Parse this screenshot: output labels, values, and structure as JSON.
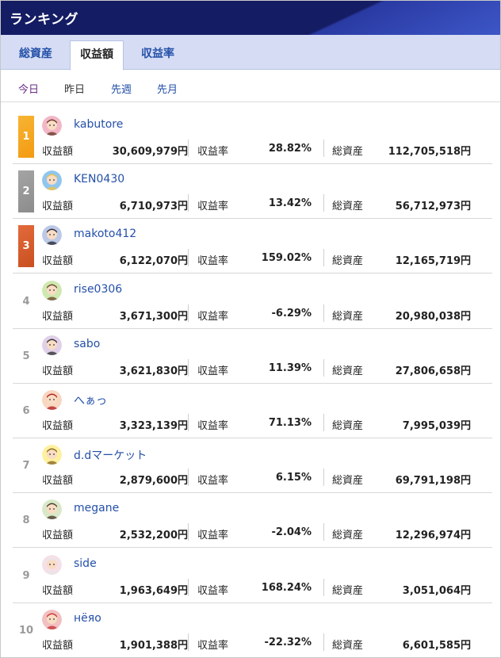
{
  "header": {
    "title": "ランキング"
  },
  "tabs": [
    {
      "label": "総資産",
      "active": false
    },
    {
      "label": "収益額",
      "active": true
    },
    {
      "label": "収益率",
      "active": false
    }
  ],
  "subtabs": [
    {
      "label": "今日"
    },
    {
      "label": "昨日"
    },
    {
      "label": "先週"
    },
    {
      "label": "先月"
    }
  ],
  "stat_labels": {
    "profit": "収益額",
    "rate": "収益率",
    "assets": "総資産"
  },
  "rows": [
    {
      "rank": "1",
      "name": "kabutore",
      "profit": "30,609,979円",
      "rate": "28.82%",
      "assets": "112,705,518円",
      "avatar": "avatar-woman-icon"
    },
    {
      "rank": "2",
      "name": "KEN0430",
      "profit": "6,710,973円",
      "rate": "13.42%",
      "assets": "56,712,973円",
      "avatar": "avatar-blonde-icon"
    },
    {
      "rank": "3",
      "name": "makoto412",
      "profit": "6,122,070円",
      "rate": "159.02%",
      "assets": "12,165,719円",
      "avatar": "avatar-suit-man-icon"
    },
    {
      "rank": "4",
      "name": "rise0306",
      "profit": "3,671,300円",
      "rate": "-6.29%",
      "assets": "20,980,038円",
      "avatar": "avatar-green-man-icon"
    },
    {
      "rank": "5",
      "name": "sabo",
      "profit": "3,621,830円",
      "rate": "11.39%",
      "assets": "27,806,658円",
      "avatar": "avatar-goggles-icon"
    },
    {
      "rank": "6",
      "name": "へぁっ",
      "profit": "3,323,139円",
      "rate": "71.13%",
      "assets": "7,995,039円",
      "avatar": "avatar-pirate-icon"
    },
    {
      "rank": "7",
      "name": "d.dマーケット",
      "profit": "2,879,600円",
      "rate": "6.15%",
      "assets": "69,791,198円",
      "avatar": "avatar-yellow-icon"
    },
    {
      "rank": "8",
      "name": "megane",
      "profit": "2,532,200円",
      "rate": "-2.04%",
      "assets": "12,296,974円",
      "avatar": "avatar-glasses-icon"
    },
    {
      "rank": "9",
      "name": "side",
      "profit": "1,963,649円",
      "rate": "168.24%",
      "assets": "3,051,064円",
      "avatar": "avatar-anime-icon"
    },
    {
      "rank": "10",
      "name": "нёяо",
      "profit": "1,901,388円",
      "rate": "-22.32%",
      "assets": "6,601,585円",
      "avatar": "avatar-redhair-icon"
    }
  ]
}
